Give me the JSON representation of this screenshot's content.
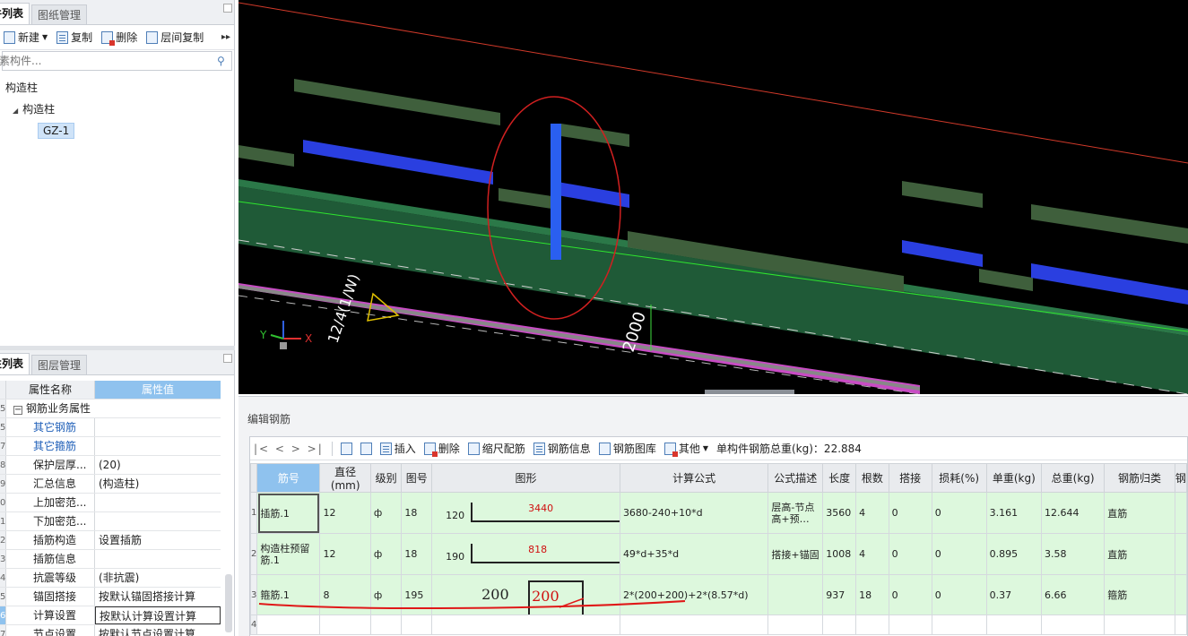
{
  "left_top": {
    "tabs": [
      "件列表",
      "图纸管理"
    ],
    "toolbar": {
      "new": "新建",
      "copy": "复制",
      "delete": "删除",
      "layer_copy": "层间复制",
      "more": "▸▸"
    },
    "search_placeholder": "素构件...",
    "tree": {
      "root": "构造柱",
      "group": "构造柱",
      "item": "GZ-1"
    }
  },
  "left_bot": {
    "tabs": [
      "性列表",
      "图层管理"
    ],
    "header": {
      "name": "属性名称",
      "value": "属性值"
    },
    "group": "钢筋业务属性",
    "rows": [
      {
        "rn": "5",
        "name": "其它钢筋",
        "value": ""
      },
      {
        "rn": "7",
        "name": "其它箍筋",
        "value": ""
      },
      {
        "rn": "8",
        "name": "保护层厚...",
        "value": "(20)"
      },
      {
        "rn": "9",
        "name": "汇总信息",
        "value": "(构造柱)"
      },
      {
        "rn": "0",
        "name": "上加密范...",
        "value": ""
      },
      {
        "rn": "1",
        "name": "下加密范...",
        "value": ""
      },
      {
        "rn": "2",
        "name": "插筋构造",
        "value": "设置插筋"
      },
      {
        "rn": "3",
        "name": "插筋信息",
        "value": ""
      },
      {
        "rn": "4",
        "name": "抗震等级",
        "value": "(非抗震)"
      },
      {
        "rn": "5",
        "name": "锚固搭接",
        "value": "按默认锚固搭接计算"
      },
      {
        "rn": "6",
        "name": "计算设置",
        "value": "按默认计算设置计算"
      },
      {
        "rn": "7",
        "name": "节点设置",
        "value": "按默认节点设置计算"
      }
    ]
  },
  "view3d": {
    "label_axis": "12/4(1/W)",
    "label_dim": "2000",
    "axis_x": "X",
    "axis_y": "Y"
  },
  "editor": {
    "title": "编辑钢筋",
    "toolbar": {
      "nav": "|<  <  >  >|",
      "insert": "插入",
      "delete": "删除",
      "scale": "缩尺配筋",
      "info": "钢筋信息",
      "library": "钢筋图库",
      "other": "其他",
      "total_label": "单构件钢筋总重(kg)：22.884"
    },
    "columns": [
      "筋号",
      "直径(mm)",
      "级别",
      "图号",
      "图形",
      "计算公式",
      "公式描述",
      "长度",
      "根数",
      "搭接",
      "损耗(%)",
      "单重(kg)",
      "总重(kg)",
      "钢筋归类",
      "钢"
    ],
    "rows": [
      {
        "rn": "1",
        "name": "插筋.1",
        "dia": "12",
        "grade": "ф",
        "fig": "18",
        "shape_left": "120",
        "shape_mid": "3440",
        "formula": "3680-240+10*d",
        "desc": "层高-节点高+预…",
        "len": "3560",
        "count": "4",
        "lap": "0",
        "loss": "0",
        "unit": "3.161",
        "total": "12.644",
        "cat": "直筋"
      },
      {
        "rn": "2",
        "name": "构造柱预留筋.1",
        "dia": "12",
        "grade": "ф",
        "fig": "18",
        "shape_left": "190",
        "shape_mid": "818",
        "formula": "49*d+35*d",
        "desc": "搭接+锚固",
        "len": "1008",
        "count": "4",
        "lap": "0",
        "loss": "0",
        "unit": "0.895",
        "total": "3.58",
        "cat": "直筋"
      },
      {
        "rn": "3",
        "name": "箍筋.1",
        "dia": "8",
        "grade": "ф",
        "fig": "195",
        "shape_left": "200",
        "shape_mid": "200",
        "formula": "2*(200+200)+2*(8.57*d)",
        "desc": "",
        "len": "937",
        "count": "18",
        "lap": "0",
        "loss": "0",
        "unit": "0.37",
        "total": "6.66",
        "cat": "箍筋"
      },
      {
        "rn": "4",
        "name": "",
        "dia": "",
        "grade": "",
        "fig": "",
        "shape_left": "",
        "shape_mid": "",
        "formula": "",
        "desc": "",
        "len": "",
        "count": "",
        "lap": "",
        "loss": "",
        "unit": "",
        "total": "",
        "cat": ""
      }
    ]
  }
}
